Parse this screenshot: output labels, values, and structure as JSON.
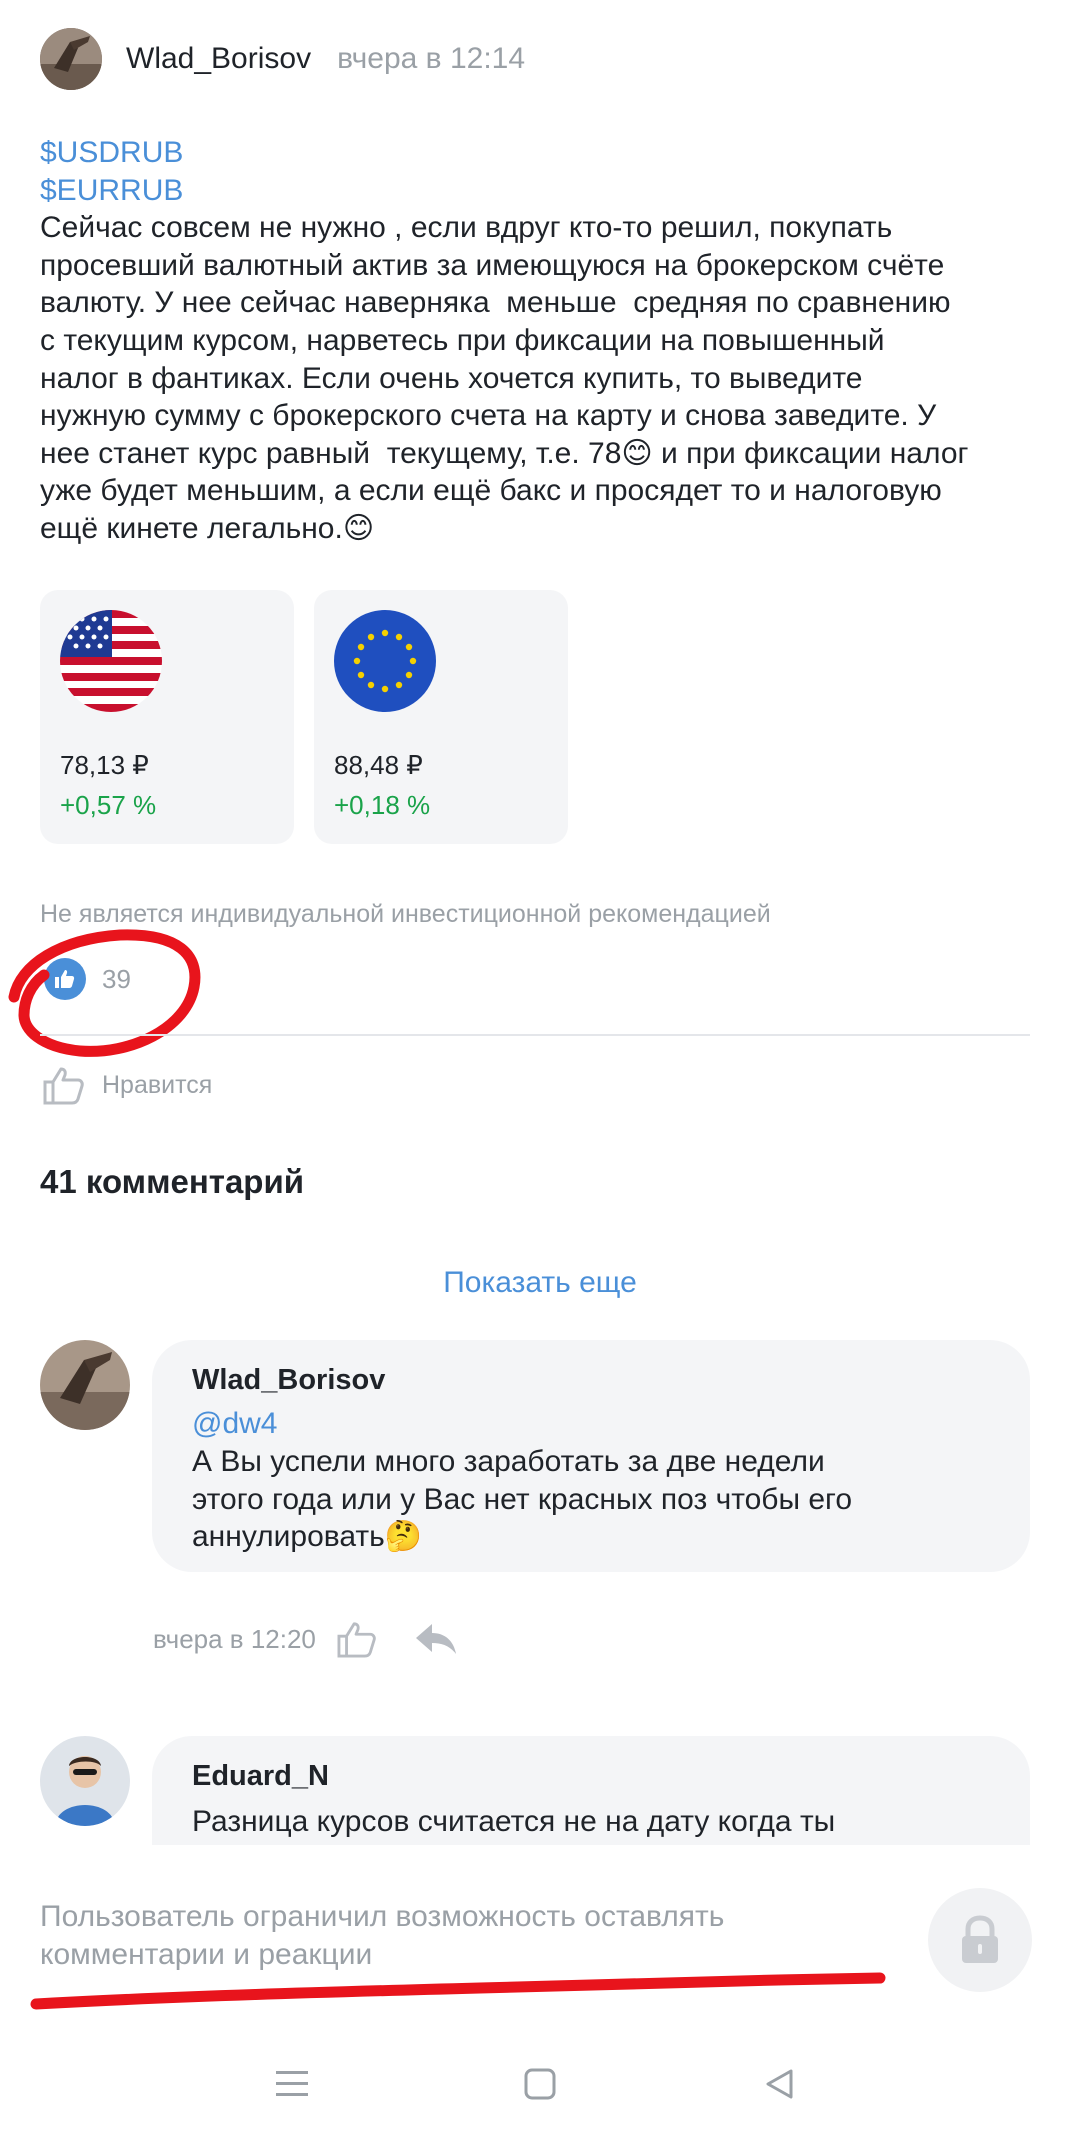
{
  "post": {
    "author": "Wlad_Borisov",
    "time": "вчера в 12:14",
    "tickers": [
      "$USDRUB",
      "$EURRUB"
    ],
    "text": "Сейчас совсем не нужно , если вдруг кто-то решил, покупать\nпросевший валютный актив за имеющуюся на брокерском счёте\nвалюту. У нее сейчас наверняка  меньше  средняя по сравнению\nс текущим курсом, нарветесь при фиксации на повышенный\nналог в фантиках. Если очень хочется купить, то выведите\nнужную сумму с брокерского счета на карту и снова заведите. У\nнее станет курс равный  текущему, т.е. 78😊 и при фиксации налог\nуже будет меньшим, а если ещё бакс и просядет то и налоговую\nещё кинете легально.😊"
  },
  "instruments": [
    {
      "flag_icon": "us-flag-icon",
      "price": "78,13  ₽",
      "change": "+0,57 %"
    },
    {
      "flag_icon": "eu-flag-icon",
      "price": "88,48  ₽",
      "change": "+0,18 %"
    }
  ],
  "disclaimer": "Не является индивидуальной инвестиционной рекомендацией",
  "reactions": {
    "count": "39",
    "like_label": "Нравится"
  },
  "comments_header": "41 комментарий",
  "show_more": "Показать еще",
  "comments": [
    {
      "author": "Wlad_Borisov",
      "mention": "@dw4",
      "text": "А Вы успели много заработать за две недели\nэтого года или у Вас нет красных поз чтобы его\nаннулировать🤔",
      "time": "вчера в 12:20"
    },
    {
      "author": "Eduard_N",
      "text": "Разница курсов считается не на дату когда ты"
    }
  ],
  "composer": {
    "note": "Пользователь ограничил возможность оставлять\nкомментарии и реакции"
  },
  "colors": {
    "accent": "#4a8fd8",
    "positive": "#1aa34a",
    "annotation": "#e8141c"
  }
}
